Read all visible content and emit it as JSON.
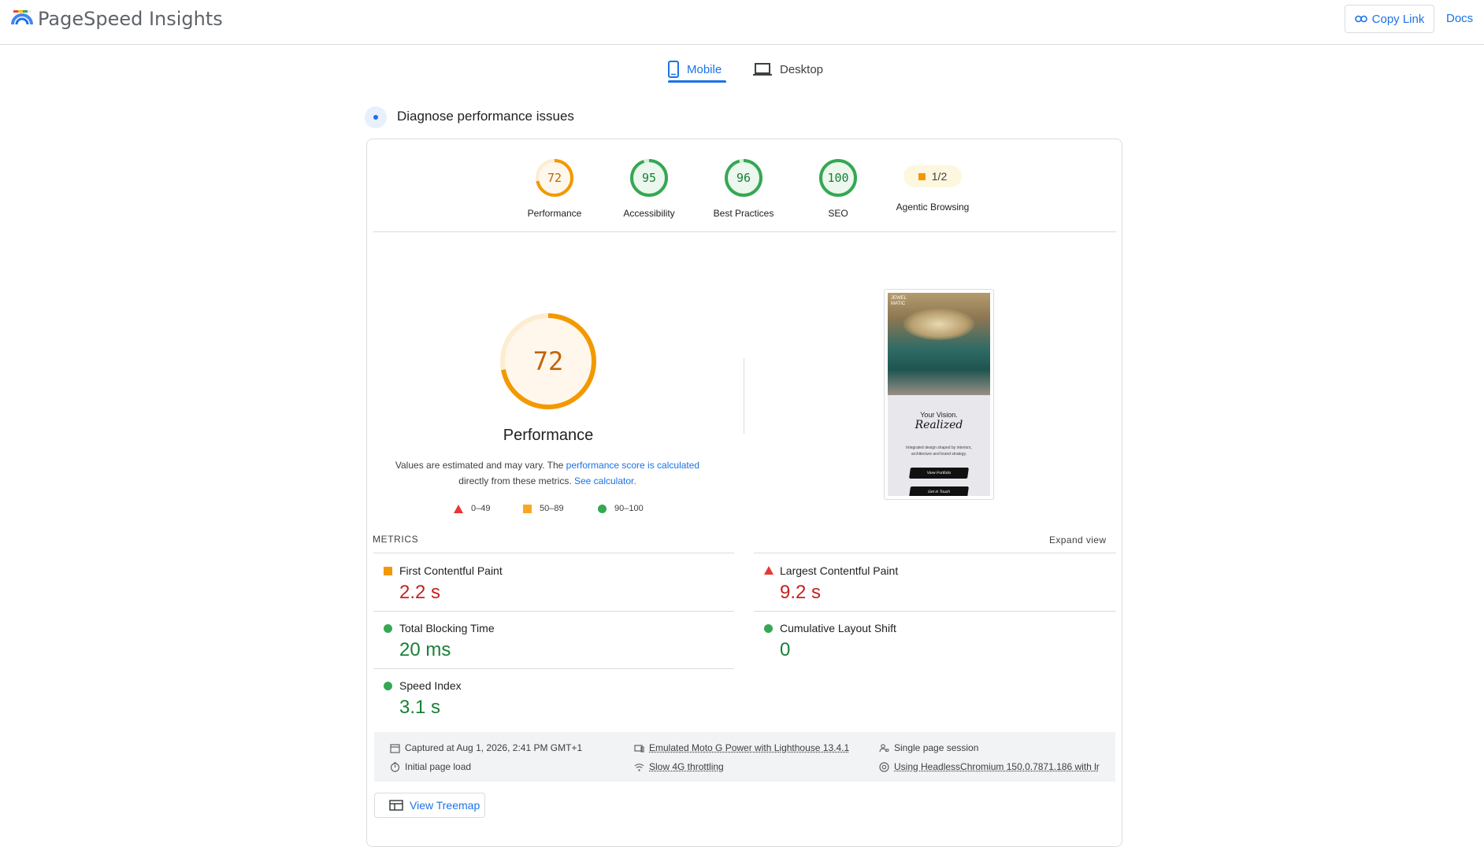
{
  "header": {
    "title": "PageSpeed Insights",
    "copy_link": "Copy Link",
    "docs": "Docs"
  },
  "tabs": [
    {
      "label": "Mobile",
      "active": true
    },
    {
      "label": "Desktop",
      "active": false
    }
  ],
  "diagnose_title": "Diagnose performance issues",
  "category_scores": [
    {
      "label": "Performance",
      "score": "72",
      "fraction": 0.72,
      "color": "#f29900",
      "text_color": "#c26401"
    },
    {
      "label": "Accessibility",
      "score": "95",
      "fraction": 0.95,
      "color": "#34a853",
      "text_color": "#188038"
    },
    {
      "label": "Best Practices",
      "score": "96",
      "fraction": 0.96,
      "color": "#34a853",
      "text_color": "#188038"
    },
    {
      "label": "SEO",
      "score": "100",
      "fraction": 1.0,
      "color": "#34a853",
      "text_color": "#188038"
    }
  ],
  "agentic": {
    "label": "Agentic Browsing",
    "value": "1/2"
  },
  "performance": {
    "score": "72",
    "fraction": 0.72,
    "title": "Performance",
    "note_prefix": "Values are estimated and may vary. The ",
    "note_link1": "performance score is calculated",
    "note_mid": "directly from these metrics. ",
    "note_link2": "See calculator."
  },
  "legend": {
    "poor": "0–49",
    "average": "50–89",
    "good": "90–100"
  },
  "screenshot": {
    "logo_line1": "JEWEL",
    "logo_line2": "MATIC",
    "heading": "Your Vision.",
    "script": "Realized",
    "tagline": "Integrated design shaped by interiors, architecture and brand strategy.",
    "btn1": "View Portfolio",
    "btn2": "Get in Touch"
  },
  "metrics": {
    "title": "METRICS",
    "expand": "Expand view",
    "fcp": {
      "name": "First Contentful Paint",
      "value": "2.2 s",
      "status": "average"
    },
    "lcp": {
      "name": "Largest Contentful Paint",
      "value": "9.2 s",
      "status": "poor"
    },
    "tbt": {
      "name": "Total Blocking Time",
      "value": "20 ms",
      "status": "good"
    },
    "cls": {
      "name": "Cumulative Layout Shift",
      "value": "0",
      "status": "good"
    },
    "si": {
      "name": "Speed Index",
      "value": "3.1 s",
      "status": "good"
    }
  },
  "runtime": {
    "captured": "Captured at Aug 1, 2026, 2:41 PM GMT+1",
    "load": "Initial page load",
    "device": "Emulated Moto G Power with Lighthouse 13.4.1",
    "throttling": "Slow 4G throttling",
    "session": "Single page session",
    "browser": "Using HeadlessChromium 150.0.7871.186 with lr"
  },
  "treemap": "View Treemap"
}
